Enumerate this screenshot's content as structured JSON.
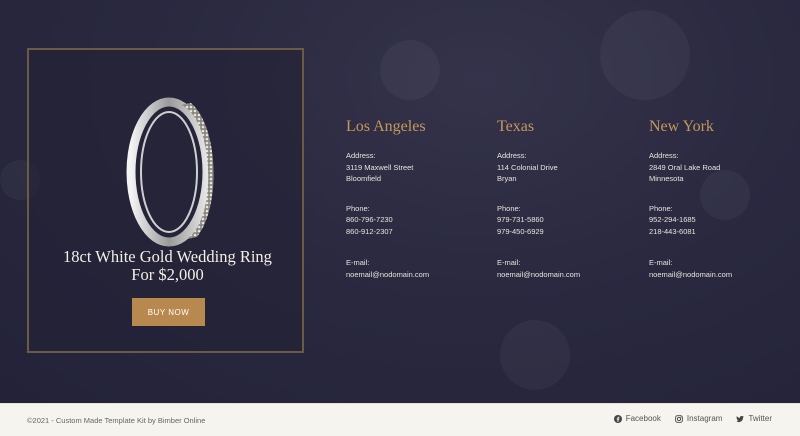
{
  "product": {
    "title_line1": "18ct White Gold Wedding Ring",
    "title_line2": "For $2,000",
    "button_label": "BUY NOW"
  },
  "locations": [
    {
      "city": "Los Angeles",
      "address_label": "Address:",
      "address_line1": "3119 Maxwell Street",
      "address_line2": "Bloomfield",
      "phone_label": "Phone:",
      "phone1": "860-796-7230",
      "phone2": "860-912-2307",
      "email_label": "E-mail:",
      "email": "noemail@nodomain.com"
    },
    {
      "city": "Texas",
      "address_label": "Address:",
      "address_line1": "114 Colonial Drive",
      "address_line2": "Bryan",
      "phone_label": "Phone:",
      "phone1": "979-731-5860",
      "phone2": "979-450-6929",
      "email_label": "E-mail:",
      "email": "noemail@nodomain.com"
    },
    {
      "city": "New York",
      "address_label": "Address:",
      "address_line1": "2849 Oral Lake Road",
      "address_line2": "Minnesota",
      "phone_label": "Phone:",
      "phone1": "952-294-1685",
      "phone2": "218-443-6081",
      "email_label": "E-mail:",
      "email": "noemail@nodomain.com"
    }
  ],
  "footer": {
    "copyright": "©2021 - Custom Made Template Kit by Bimber Online",
    "social": [
      {
        "label": "Facebook",
        "icon": "facebook-icon"
      },
      {
        "label": "Instagram",
        "icon": "instagram-icon"
      },
      {
        "label": "Twitter",
        "icon": "twitter-icon"
      }
    ]
  },
  "colors": {
    "background": "#2a2940",
    "accent": "#c6975c",
    "button": "#b8894f",
    "footer": "#f6f4ef"
  }
}
